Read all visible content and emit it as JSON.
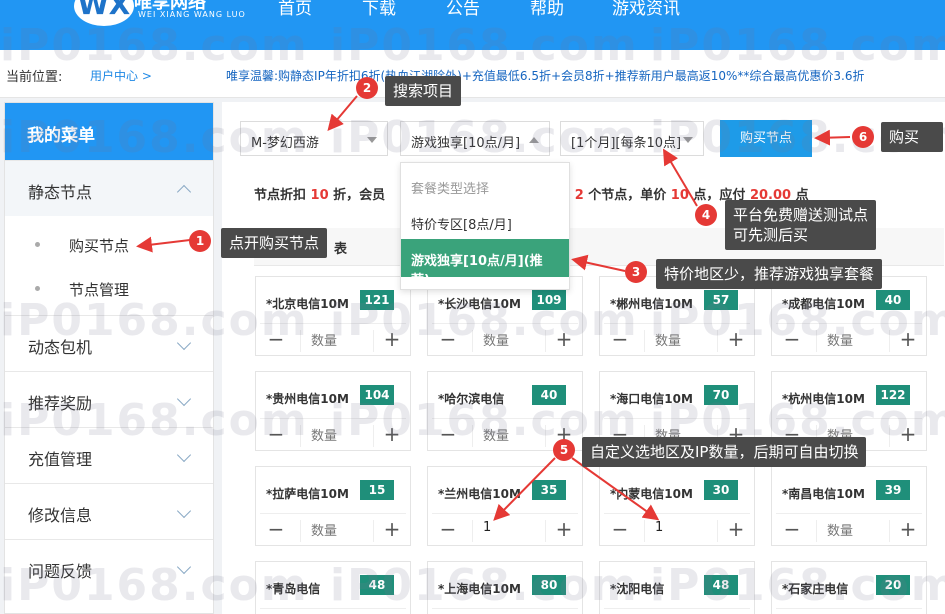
{
  "nav": {
    "logo_mark": "WX",
    "logo_name": "唯享网络",
    "logo_sub": "WEI XIANG WANG LUO",
    "links": [
      "首页",
      "下载",
      "公告",
      "帮助",
      "游戏资讯"
    ]
  },
  "breadcrumb": {
    "label": "当前位置:",
    "link": "用户中心 >"
  },
  "notice": "唯享温馨:购静态IP年折扣6折(热血江湖除外)+充值最低6.5折+会员8折+推荐新用户最高返10%**综合最高优惠价3.6折",
  "sidebar": {
    "title": "我的菜单",
    "groups": [
      "静态节点",
      "动态包机",
      "推荐奖励",
      "充值管理",
      "修改信息",
      "问题反馈"
    ],
    "sub_items": [
      "购买节点",
      "节点管理"
    ]
  },
  "filters": {
    "game": "M-梦幻西游",
    "package": "游戏独享[10点/月]",
    "period": "[1个月][每条10点]",
    "buy_button": "购买节点"
  },
  "dropdown": {
    "hint": "套餐类型选择",
    "options": [
      "特价专区[8点/月]",
      "游戏独享[10点/月](推荐)"
    ]
  },
  "summary": {
    "p1": "节点折扣 ",
    "discount": "10",
    "p2": " 折，会员",
    "p3": "区 ",
    "nodes": "2",
    "p4": " 个节点，单价 ",
    "price": "10",
    "p5": " 点，应付 ",
    "total": "20.00",
    "p6": " 点",
    "section_suffix": "表"
  },
  "nodes": [
    {
      "name": "*北京电信10M",
      "count": "121",
      "qty": "数量"
    },
    {
      "name": "*长沙电信10M",
      "count": "109",
      "qty": "数量"
    },
    {
      "name": "*郴州电信10M",
      "count": "57",
      "qty": "数量"
    },
    {
      "name": "*成都电信10M",
      "count": "40",
      "qty": "数量"
    },
    {
      "name": "*贵州电信10M",
      "count": "104",
      "qty": "数量"
    },
    {
      "name": "*哈尔滨电信",
      "count": "40",
      "qty": "数量"
    },
    {
      "name": "*海口电信10M",
      "count": "70",
      "qty": "数量"
    },
    {
      "name": "*杭州电信10M",
      "count": "122",
      "qty": "数量"
    },
    {
      "name": "*拉萨电信10M",
      "count": "15",
      "qty": "数量"
    },
    {
      "name": "*兰州电信10M",
      "count": "35",
      "qty": "1"
    },
    {
      "name": "*内蒙电信10M",
      "count": "30",
      "qty": "1"
    },
    {
      "name": "*南昌电信10M",
      "count": "39",
      "qty": "数量"
    },
    {
      "name": "*青岛电信",
      "count": "48",
      "qty": ""
    },
    {
      "name": "*上海电信10M",
      "count": "80",
      "qty": ""
    },
    {
      "name": "*沈阳电信",
      "count": "48",
      "qty": ""
    },
    {
      "name": "*石家庄电信",
      "count": "20",
      "qty": ""
    }
  ],
  "stepper": {
    "minus": "−",
    "plus": "+"
  },
  "watermark": "iP0168.com",
  "annotations": {
    "n1": "1",
    "t1": "点开购买节点",
    "n2": "2",
    "t2": "搜索项目",
    "n3": "3",
    "t3": "特价地区少，推荐游戏独享套餐",
    "n4": "4",
    "t4a": "平台免费赠送测试点",
    "t4b": "可先测后买",
    "n5": "5",
    "t5": "自定义选地区及IP数量，后期可自由切换",
    "n6": "6",
    "t6": "购买"
  },
  "colors": {
    "accent": "#2196f3",
    "count_badge": "#1f8f7a",
    "selected": "#3aa37b",
    "badge": "#e53935"
  }
}
